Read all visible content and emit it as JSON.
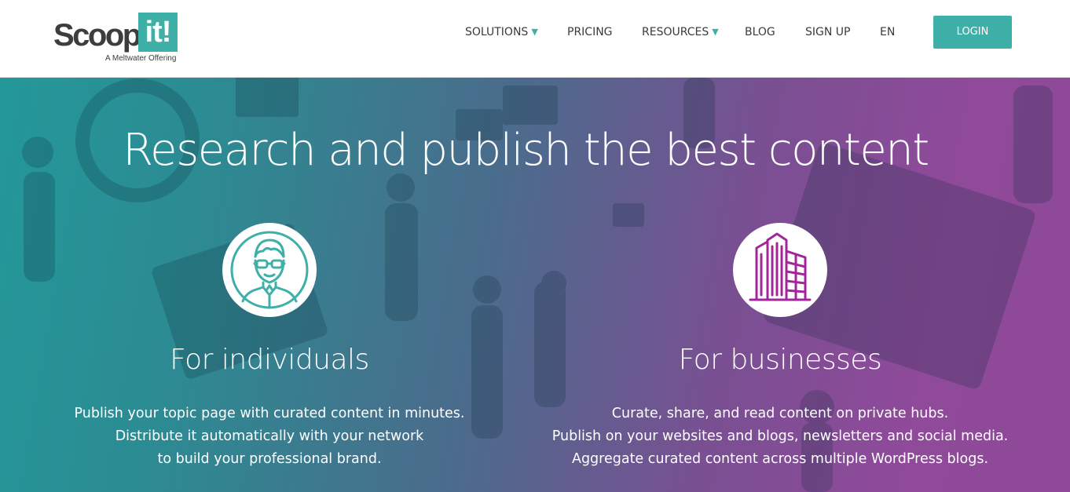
{
  "brand": {
    "name_part1": "Scoop.",
    "name_part2": "it!",
    "tagline": "A Meltwater Offering",
    "accent_color": "#3fb0a8"
  },
  "nav": {
    "items": [
      {
        "label": "SOLUTIONS",
        "has_dropdown": true
      },
      {
        "label": "PRICING",
        "has_dropdown": false
      },
      {
        "label": "RESOURCES",
        "has_dropdown": true
      },
      {
        "label": "BLOG",
        "has_dropdown": false
      },
      {
        "label": "SIGN UP",
        "has_dropdown": false
      },
      {
        "label": "EN",
        "has_dropdown": false
      }
    ],
    "dropdown_caret": "▼",
    "login_label": "LOGIN"
  },
  "hero": {
    "title": "Research and publish the best content",
    "gradient_colors": [
      "#23989a",
      "#8e4a98"
    ],
    "individuals": {
      "icon": "person-with-glasses-icon",
      "icon_color": "#3fb0a8",
      "title": "For individuals",
      "lines": [
        "Publish your topic page with curated content in minutes.",
        "Distribute it automatically with your network",
        "to build your professional brand."
      ]
    },
    "businesses": {
      "icon": "office-buildings-icon",
      "icon_color": "#a3259b",
      "title": "For businesses",
      "lines": [
        "Curate, share, and read content on private hubs.",
        "Publish on your websites and blogs, newsletters and social media.",
        "Aggregate curated content across multiple WordPress blogs."
      ]
    }
  }
}
